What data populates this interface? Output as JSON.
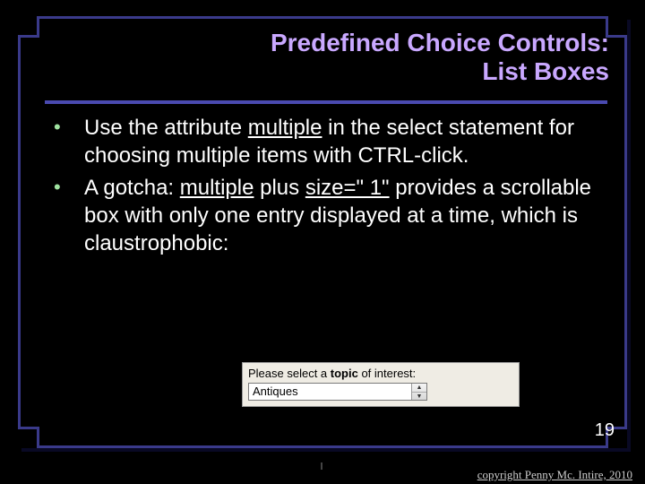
{
  "title_line1": "Predefined Choice Controls:",
  "title_line2": "List Boxes",
  "bullets": [
    {
      "pre": "Use the attribute ",
      "u": "multiple",
      "post": " in the select statement for choosing multiple items with CTRL-click."
    },
    {
      "pre": "A gotcha: ",
      "u": "multiple",
      "mid": " plus ",
      "u2": "size=\" 1\"",
      "post": " provides a scrollable box with only one entry displayed at a time, which is claustrophobic:"
    }
  ],
  "example": {
    "label_pre": "Please select a ",
    "label_bold": "topic",
    "label_post": " of interest:",
    "value": "Antiques"
  },
  "page_number": "19",
  "copyright": "copyright Penny Mc. Intire, 2010"
}
